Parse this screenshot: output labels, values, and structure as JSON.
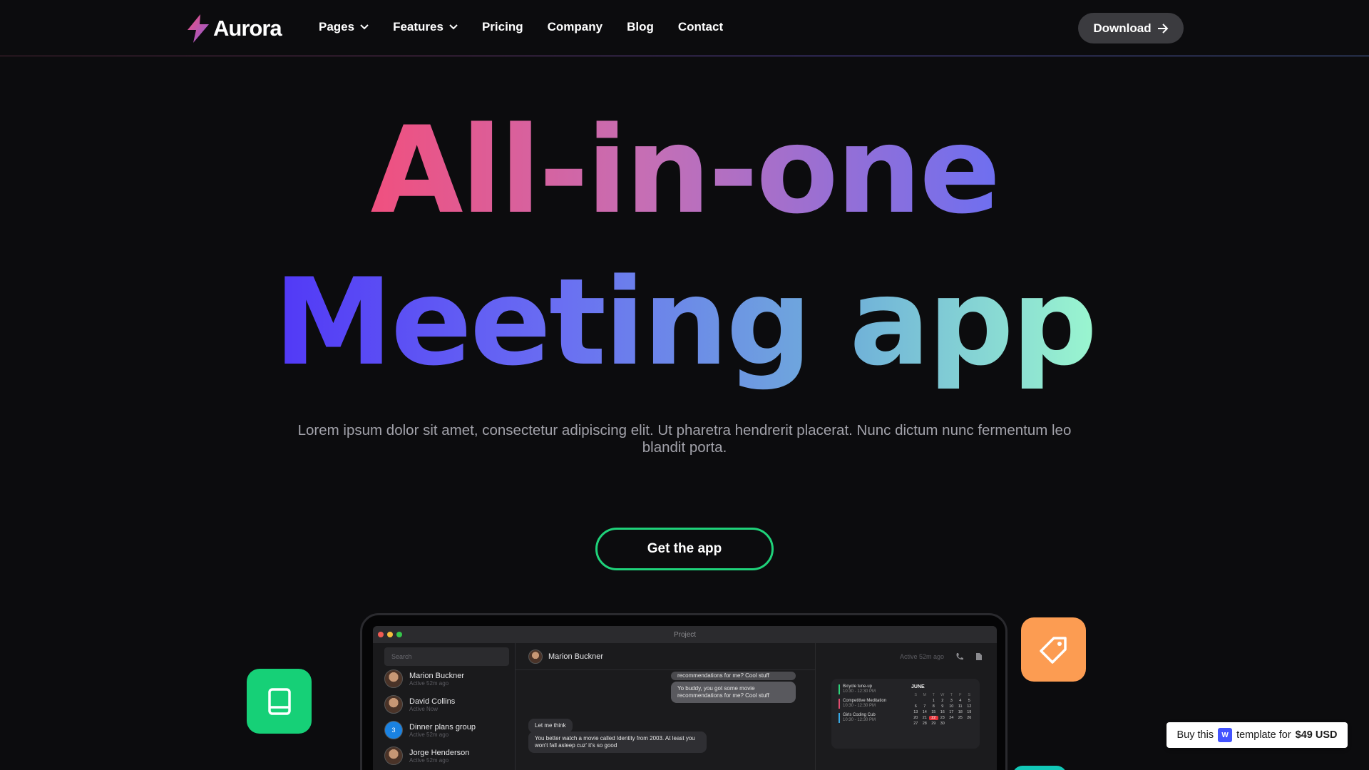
{
  "brand": {
    "name": "Aurora",
    "accent": "#e86aa0"
  },
  "nav": {
    "items": [
      {
        "label": "Pages",
        "has_dropdown": true
      },
      {
        "label": "Features",
        "has_dropdown": true
      },
      {
        "label": "Pricing",
        "has_dropdown": false
      },
      {
        "label": "Company",
        "has_dropdown": false
      },
      {
        "label": "Blog",
        "has_dropdown": false
      },
      {
        "label": "Contact",
        "has_dropdown": false
      }
    ],
    "download_label": "Download"
  },
  "hero": {
    "line1": "All-in-one",
    "line2": "Meeting app",
    "lead": "Lorem ipsum dolor sit amet, consectetur adipiscing elit. Ut pharetra hendrerit placerat. Nunc dictum nunc fermentum leo blandit porta.",
    "cta_label": "Get the app",
    "cta_color": "#1fd27a"
  },
  "mockup": {
    "window_title": "Project",
    "search_placeholder": "Search",
    "contacts": [
      {
        "name": "Marion Buckner",
        "status": "Active 52m ago"
      },
      {
        "name": "David Collins",
        "status": "Active Now"
      },
      {
        "name": "Dinner plans group",
        "status": "Active 52m ago",
        "badge": "3"
      },
      {
        "name": "Jorge Henderson",
        "status": "Active 52m ago"
      }
    ],
    "chat": {
      "name": "Marion Buckner",
      "status": "Active 52m ago",
      "messages": [
        "recommendations for me? Cool stuff",
        "Yo buddy, you got some movie recommendations for me? Cool stuff",
        "Let me think",
        "You better watch a movie called Identity from 2003. At least you won't fall asleep cuz' it's so good"
      ]
    },
    "calendar": {
      "events": [
        {
          "title": "Bicycle tune-up",
          "time": "10:30 - 12:30 PM",
          "color": "#2fd27a"
        },
        {
          "title": "Competitive Meditation",
          "time": "10:30 - 12:30 PM",
          "color": "#e14c6f"
        },
        {
          "title": "Girls Coding Cub",
          "time": "10:30 - 12:30 PM",
          "color": "#37a9e6"
        }
      ],
      "month": "JUNE",
      "weekdays": [
        "S",
        "M",
        "T",
        "W",
        "T",
        "F",
        "S"
      ],
      "days": [
        "",
        "",
        "1",
        "2",
        "3",
        "4",
        "5",
        "6",
        "7",
        "8",
        "9",
        "10",
        "11",
        "12",
        "13",
        "14",
        "15",
        "16",
        "17",
        "18",
        "19",
        "20",
        "21",
        "22",
        "23",
        "24",
        "25",
        "26",
        "27",
        "28",
        "29",
        "30"
      ],
      "today": "22"
    }
  },
  "badge": {
    "prefix": "Buy this",
    "middle": "template for",
    "price": "$49 USD"
  }
}
